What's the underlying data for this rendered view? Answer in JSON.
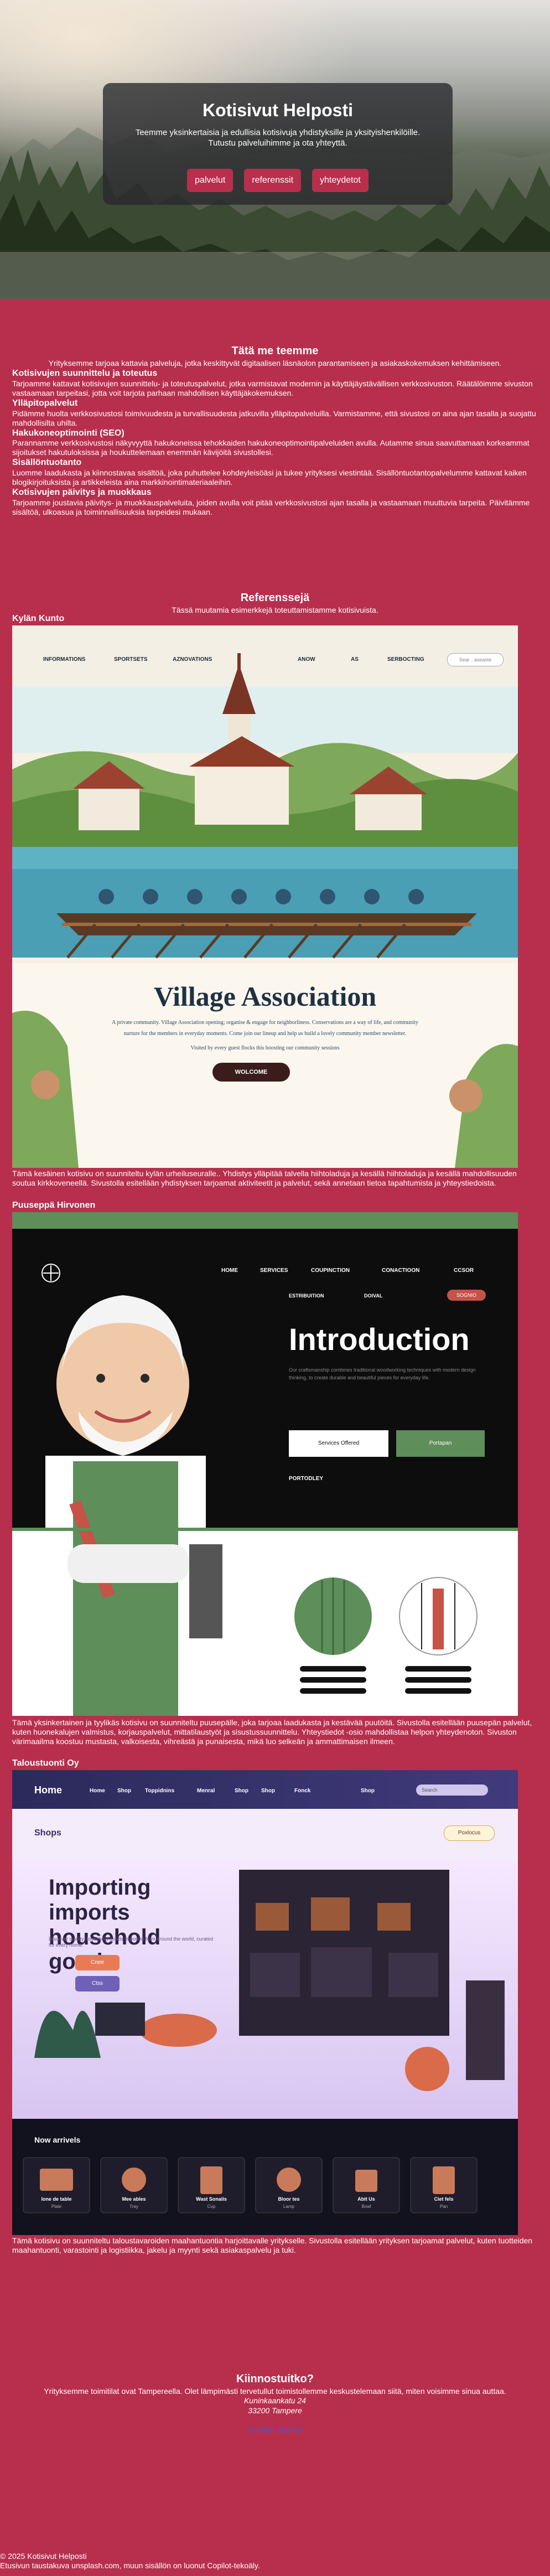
{
  "hero": {
    "title": "Kotisivut Helposti",
    "subtitle": "Teemme yksinkertaisia ja edullisia kotisivuja yhdistyksille ja yksityishenkilöille. Tutustu palveluihimme ja ota yhteyttä.",
    "buttons": [
      "palvelut",
      "referenssit",
      "yhteydetot"
    ]
  },
  "services": {
    "title": "Tätä me teemme",
    "intro": "Yrityksemme tarjoaa kattavia palveluja, jotka keskittyvät digitaalisen läsnäolon parantamiseen ja asiakaskokemuksen kehittämiseen.",
    "items": [
      {
        "title": "Kotisivujen suunnittelu ja toteutus",
        "text": "Tarjoamme kattavat kotisivujen suunnittelu- ja toteutuspalvelut, jotka varmistavat modernin ja käyttäjäystävällisen verkkosivuston. Räätälöimme sivuston vastaamaan tarpeitasi, jotta voit tarjota parhaan mahdollisen käyttäjäkokemuksen."
      },
      {
        "title": "Ylläpitopalvelut",
        "text": "Pidämme huolta verkkosivustosi toimivuudesta ja turvallisuudesta jatkuvilla ylläpitopalveluilla. Varmistamme, että sivustosi on aina ajan tasalla ja suojattu mahdollisilta uhilta."
      },
      {
        "title": "Hakukoneoptimointi (SEO)",
        "text": "Parannamme verkkosivustosi näkyvyyttä hakukoneissa tehokkaiden hakukoneoptimointipalveluiden avulla. Autamme sinua saavuttamaan korkeammat sijoitukset hakutuloksissa ja houkuttelemaan enemmän kävijöitä sivustollesi."
      },
      {
        "title": "Sisällöntuotanto",
        "text": "Luomme laadukasta ja kiinnostavaa sisältöä, joka puhuttelee kohdeyleisöäsi ja tukee yrityksesi viestintää. Sisällöntuotantopalvelumme kattavat kaiken blogikirjoituksista ja artikkeleista aina markkinointimateriaaleihin."
      },
      {
        "title": "Kotisivujen päivitys ja muokkaus",
        "text": "Tarjoamme joustavia päivitys- ja muokkauspalveluita, joiden avulla voit pitää verkkosivustosi ajan tasalla ja vastaamaan muuttuvia tarpeita. Päivitämme sisältöä, ulkoasua ja toiminnallisuuksia tarpeidesi mukaan."
      }
    ]
  },
  "references": {
    "title": "Referenssejä",
    "intro": "Tässä muutamia esimerkkejä toteuttamistamme kotisivuista.",
    "items": [
      {
        "name": "Kylän Kunto",
        "text": "Tämä kesäinen kotisivu on suunniteltu kylän urheiluseuralle.. Yhdistys ylläpitää talvella hiihtoladuja ja kesällä hiihtoladuja ja kesällä mahdollisuuden soutua kirkkoveneellä. Sivustolla esitellään yhdistyksen tarjoamat aktiviteetit ja palvelut, sekä annetaan tietoa tapahtumista ja yhteystiedoista.",
        "mock": {
          "nav": [
            "INFORMATIONS",
            "SPORTSETS",
            "AZNOVATIONS",
            "ANOW",
            "AS",
            "SERBOCTING"
          ],
          "search": "Sear · aseaste",
          "heading": "Village Association",
          "body1": "A private community. Village Association opening; organise & engage for neighborliness. Conservations are a way of life, and community",
          "body2": "nurture for the members in everyday moments. Come join our lineup and help us build a lovely community member newsletter.",
          "body3": "Visited by every guest flocks this boosting our community sessions",
          "cta": "WOLCOME"
        }
      },
      {
        "name": "Puuseppä Hirvonen",
        "text": "Tämä yksinkertainen ja tyylikäs kotisivu on suunniteltu puusepälle, joka tarjoaa laadukasta ja kestävää puutöitä. Sivustolla esitellään puusepän palvelut, kuten huonekalujen valmistus, korjauspalvelut, mittatilaustyöt ja sisustussuunnittelu. Yhteystiedot -osio mahdollistaa helpon yhteydenoton. Sivuston värimaailma koostuu mustasta, valkoisesta, vihreästä ja punaisesta, mikä luo selkeän ja ammattimaisen ilmeen.",
        "mock": {
          "nav": [
            "HOME",
            "SERVICES",
            "COUPINCTION",
            "CONACTIOON",
            "CCSOR"
          ],
          "subnav": [
            "ESTRIBUITION",
            "DOIVAL"
          ],
          "subnav_button": "SOGNIO",
          "heading": "Introduction",
          "lorem": "Our craftsmanship combines traditional woodworking techniques with modern design thinking, to create durable and beautiful pieces for everyday life.",
          "btn1": "Services Offered",
          "btn2": "Portapan",
          "label": "PORTODLEY"
        }
      },
      {
        "name": "Taloustuonti Oy",
        "text": "Tämä kotisivu on suunniteltu taloustavaroiden maahantuontia harjoittavalle yritykselle. Sivustolla esitellään yrityksen tarjoamat palvelut, kuten tuotteiden maahantuonti, varastointi ja logistiikka, jakelu ja myynti sekä asiakaspalvelu ja tuki.",
        "mock": {
          "logo": "Home",
          "nav": [
            "Home",
            "Shop",
            "Toppidnins",
            "Menral",
            "Shop",
            "Shop",
            "Fonck"
          ],
          "nav_shop": "Shop",
          "secondary_logo": "Shops",
          "search": "Search",
          "right_button": "Poxlocus",
          "heading": "Importing imports household goods",
          "hero_body": "Discover quality household goods imported from around the world, curated for every home.",
          "cta1": "Cnee",
          "cta2": "Ctss",
          "new_title": "Now arrivels",
          "products": [
            "Ione de table",
            "Mee ables",
            "Wast Sonalis",
            "Bloor tes",
            "Abit Us",
            "Ciet fels"
          ],
          "products_sub": [
            "Plate",
            "Tray",
            "Cup",
            "Lamp",
            "Bowl",
            "Pan"
          ]
        }
      }
    ]
  },
  "contact": {
    "title": "Kiinnostuitko?",
    "text": "Yrityksemme toimitilat ovat Tampereella. Olet lämpimästi tervetullut toimistollemme keskustelemaan siitä, miten voisimme sinua auttaa.",
    "address1": "Kuninkaankatu 24",
    "address2": "33200 Tampere",
    "phone": "0400 750743",
    "phone_icon": "phone-icon"
  },
  "footer": {
    "copyright": "© 2025 Kotisivut Helposti",
    "credit": "Etusivun taustakuva unsplash.com, muun sisällön on luonut Copilot-tekoäly."
  },
  "colors": {
    "page_bg": "#b72f4d",
    "hero_card": "#2c2c30",
    "button": "#b72f4d"
  }
}
